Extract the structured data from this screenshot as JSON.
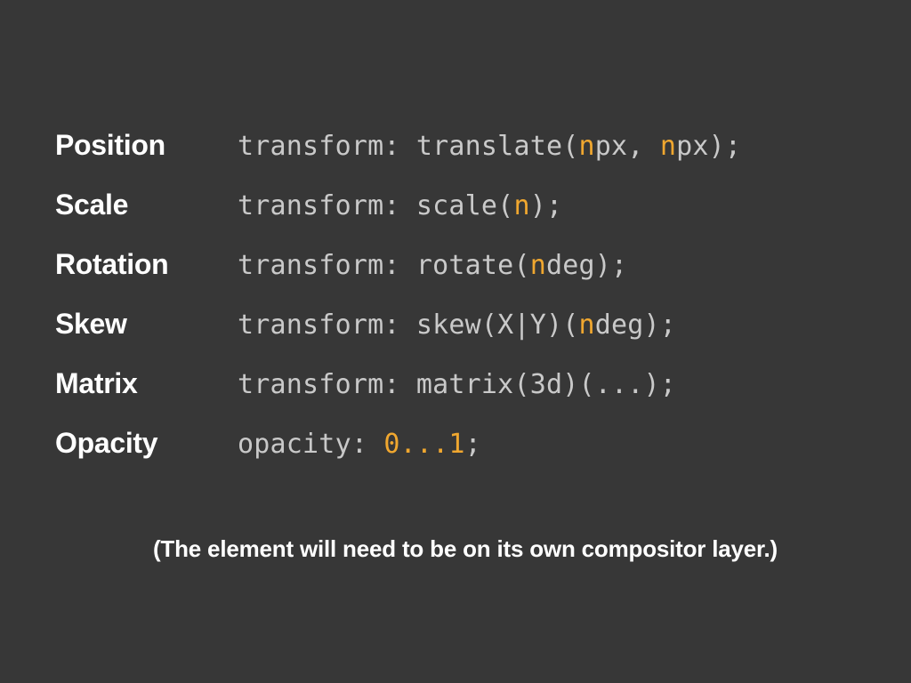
{
  "rows": [
    {
      "label": "Position",
      "code": [
        {
          "text": "transform: translate(",
          "hl": false
        },
        {
          "text": "n",
          "hl": true
        },
        {
          "text": "px, ",
          "hl": false
        },
        {
          "text": "n",
          "hl": true
        },
        {
          "text": "px);",
          "hl": false
        }
      ]
    },
    {
      "label": "Scale",
      "code": [
        {
          "text": "transform: scale(",
          "hl": false
        },
        {
          "text": "n",
          "hl": true
        },
        {
          "text": ");",
          "hl": false
        }
      ]
    },
    {
      "label": "Rotation",
      "code": [
        {
          "text": "transform: rotate(",
          "hl": false
        },
        {
          "text": "n",
          "hl": true
        },
        {
          "text": "deg);",
          "hl": false
        }
      ]
    },
    {
      "label": "Skew",
      "code": [
        {
          "text": "transform: skew(X|Y)(",
          "hl": false
        },
        {
          "text": "n",
          "hl": true
        },
        {
          "text": "deg);",
          "hl": false
        }
      ]
    },
    {
      "label": "Matrix",
      "code": [
        {
          "text": "transform: matrix(3d)(...);",
          "hl": false
        }
      ]
    },
    {
      "label": "Opacity",
      "code": [
        {
          "text": "opacity: ",
          "hl": false
        },
        {
          "text": "0...1",
          "hl": true
        },
        {
          "text": ";",
          "hl": false
        }
      ]
    }
  ],
  "footnote": "(The element will need to be on its own compositor layer.)"
}
